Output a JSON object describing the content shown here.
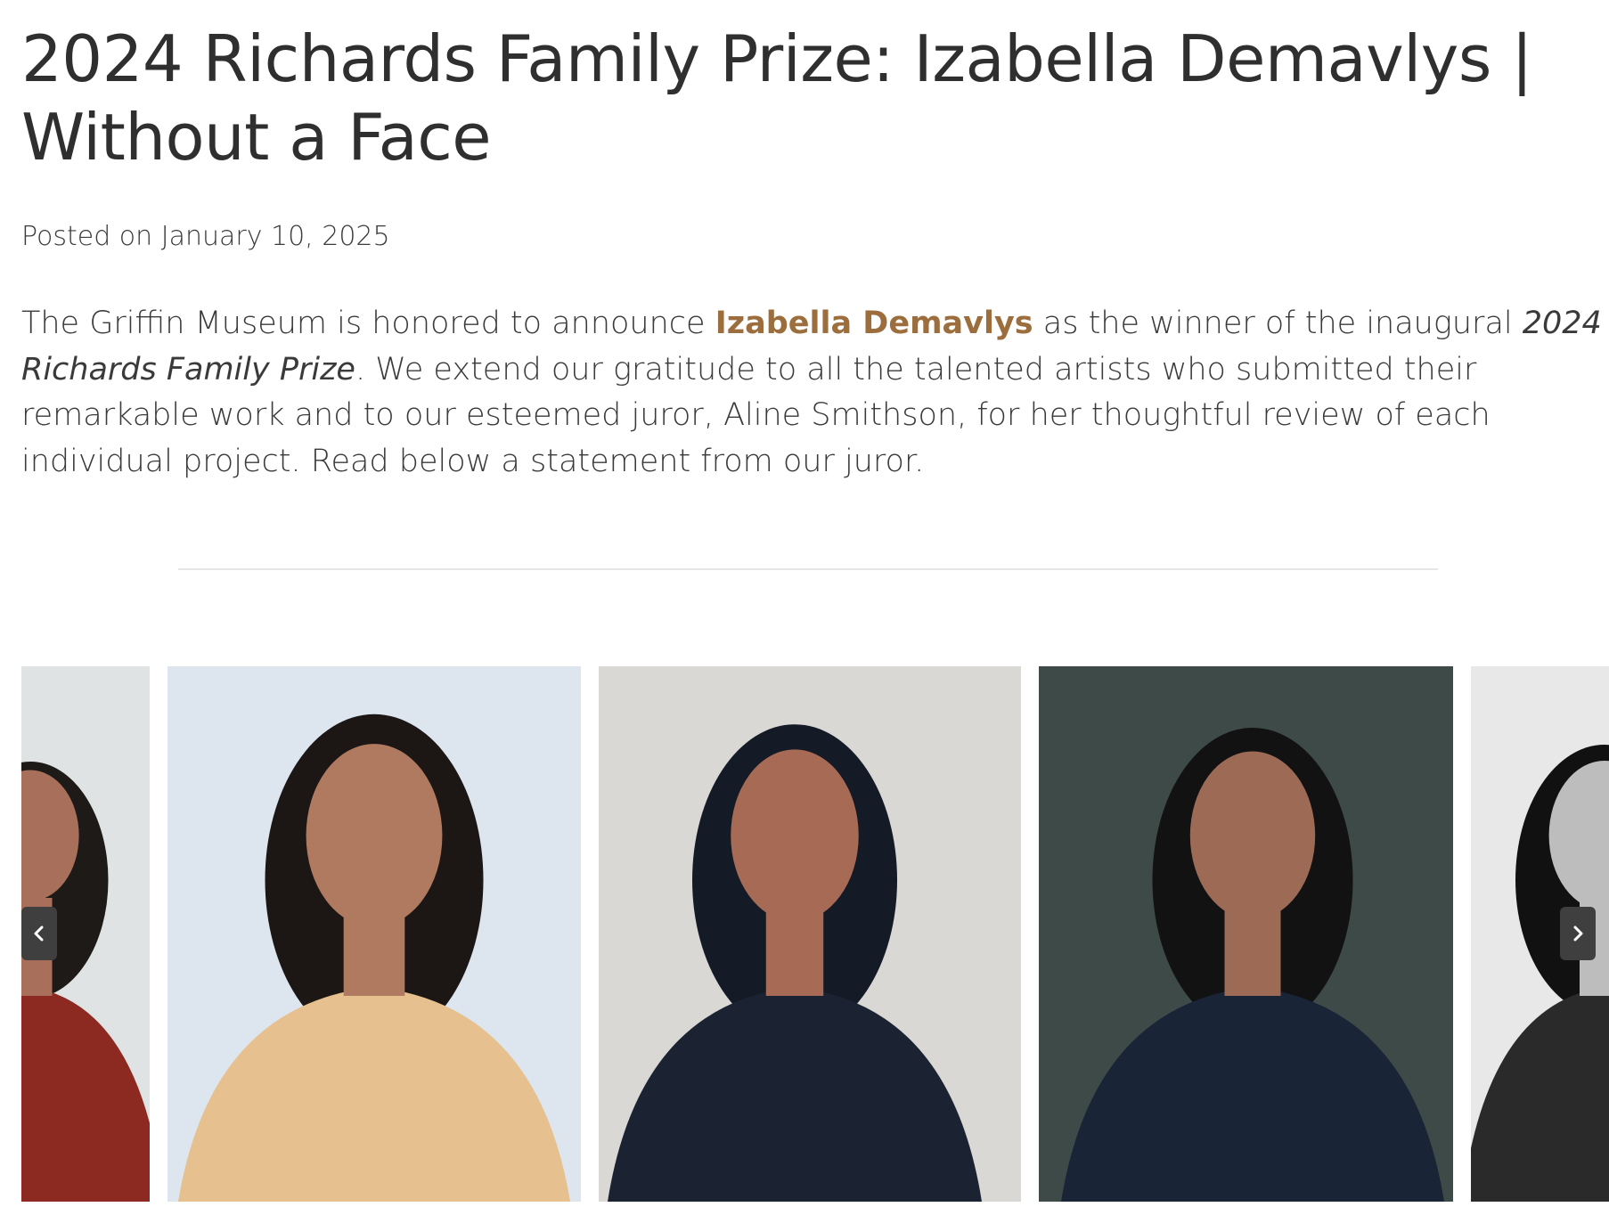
{
  "article": {
    "title": "2024 Richards Family Prize: Izabella Demavlys | Without a Face",
    "posted_label": "Posted on",
    "posted_date": "January 10, 2025",
    "intro": {
      "part1": "The Griffin Museum is honored to announce ",
      "artist_link": "Izabella Demavlys",
      "part2": " as the winner of the inaugural ",
      "prize_name": "2024 Richards Family Prize",
      "part3": ". We extend our gratitude to all the talented artists who submitted their remarkable work and to our esteemed juror, Aline Smithson, for her thoughtful review of each individual project. Read below a statement from our juror."
    }
  },
  "gallery": {
    "prev_icon": "chevron-left-icon",
    "next_icon": "chevron-right-icon",
    "slides": [
      {
        "name": "portrait-partial-left",
        "bg": "#dfe3e4",
        "garment": "#8c2a22",
        "hair": "#1e1a18",
        "skin": "#a8705a"
      },
      {
        "name": "portrait-beige-scarf",
        "bg": "#dde6ef",
        "garment": "#e6c08e",
        "hair": "#1c1614",
        "skin": "#b07a60"
      },
      {
        "name": "portrait-black-hijab",
        "bg": "#d9d8d5",
        "garment": "#1b2232",
        "hair": "#141a26",
        "skin": "#a66a55"
      },
      {
        "name": "portrait-dark-room",
        "bg": "#3e4a48",
        "garment": "#1a2437",
        "hair": "#121212",
        "skin": "#9c6a55"
      },
      {
        "name": "portrait-bw-partial-right",
        "bg": "#e8e8e8",
        "garment": "#2a2a2a",
        "hair": "#111111",
        "skin": "#bdbdbd"
      }
    ]
  }
}
